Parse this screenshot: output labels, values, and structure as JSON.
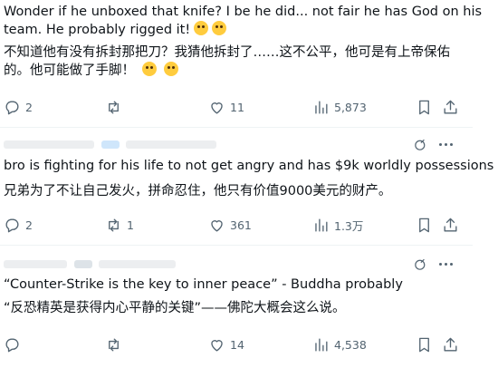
{
  "posts": [
    {
      "lines": [
        "Wonder if he unboxed that knife? I be he did... not fair he has God on his",
        "team. He probably rigged it!",
        "不知道他有没有拆封那把刀？我猜他拆封了……这不公平，他可是有上帝保佑",
        "的。他可能做了手脚！"
      ],
      "emojis": [
        "rofl-emoji",
        "joy-emoji"
      ],
      "reply_count": "2",
      "repost_count": "",
      "like_count": "11",
      "view_count": "5,873"
    },
    {
      "lines": [
        "bro is fighting for his life to not get angry and has $9k worldly possessions",
        "兄弟为了不让自己发火，拼命忍住，他只有价值9000美元的财产。"
      ],
      "reply_count": "2",
      "repost_count": "1",
      "like_count": "361",
      "view_count": "1.3万"
    },
    {
      "lines": [
        "“Counter-Strike is the key to inner peace” - Buddha probably",
        "“反恐精英是获得内心平静的关键”——佛陀大概会这么说。"
      ],
      "reply_count": "",
      "repost_count": "",
      "like_count": "14",
      "view_count": "4,538"
    }
  ],
  "colors": {
    "icon": "#536471",
    "text": "#0f1419",
    "divider": "#eff3f4",
    "emoji": "#ffcc3e"
  }
}
